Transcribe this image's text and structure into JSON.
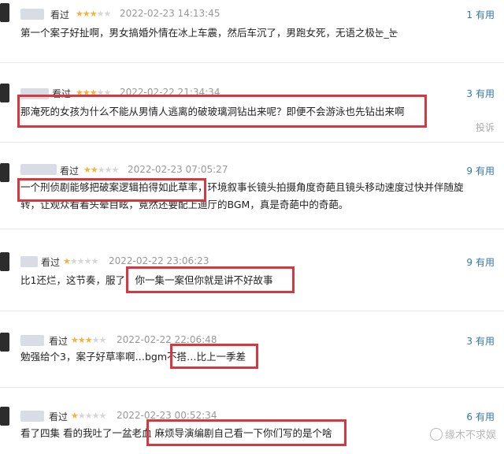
{
  "reviews": [
    {
      "watched": "看过",
      "rating": 3,
      "time": "2022-02-23 14:13:45",
      "useful_count": "1",
      "useful_label": "有用",
      "content": "第一个案子好扯啊，男女搞婚外情在冰上车震，然后车沉了，男跑女死，无语之极눈_눈"
    },
    {
      "watched": "看过",
      "rating": 3,
      "time": "2022-02-22 21:34:34",
      "useful_count": "3",
      "useful_label": "有用",
      "content": "那淹死的女孩为什么不能从男情人逃离的破玻璃洞钻出来呢？即便不会游泳也先钻出来啊",
      "report": "投诉"
    },
    {
      "watched": "看过",
      "rating": 2,
      "time": "2022-02-23 07:05:27",
      "useful_count": "9",
      "useful_label": "有用",
      "content": "一个刑侦剧能够把破案逻辑拍得如此草率，环境叙事长镜头拍摄角度奇葩且镜头移动速度过快并伴随旋转，让观众看着头晕目眩，竟然还要配上迪厅的BGM，真是奇葩中的奇葩。"
    },
    {
      "watched": "看过",
      "rating": 1,
      "time": "2022-02-22 23:06:23",
      "useful_count": "9",
      "useful_label": "有用",
      "content": "比1还烂，这节奏，服了，你一集一案但你就是讲不好故事"
    },
    {
      "watched": "看过",
      "rating": 3,
      "time": "2022-02-22 22:06:48",
      "useful_count": "3",
      "useful_label": "有用",
      "content": "勉强给个3，案子好草率啊…bgm不搭…比上一季差"
    },
    {
      "watched": "看过",
      "rating": 1,
      "time": "2022-02-23 00:52:34",
      "useful_count": "6",
      "useful_label": "有用",
      "content": "看了四集 看的我吐了一盆老血 麻烦导演编剧自己看一下你们写的是个啥"
    }
  ],
  "watermark": "缘木不求娱",
  "colors": {
    "highlight": "#d8373f",
    "star": "#f4b23a",
    "link": "#3377aa"
  }
}
